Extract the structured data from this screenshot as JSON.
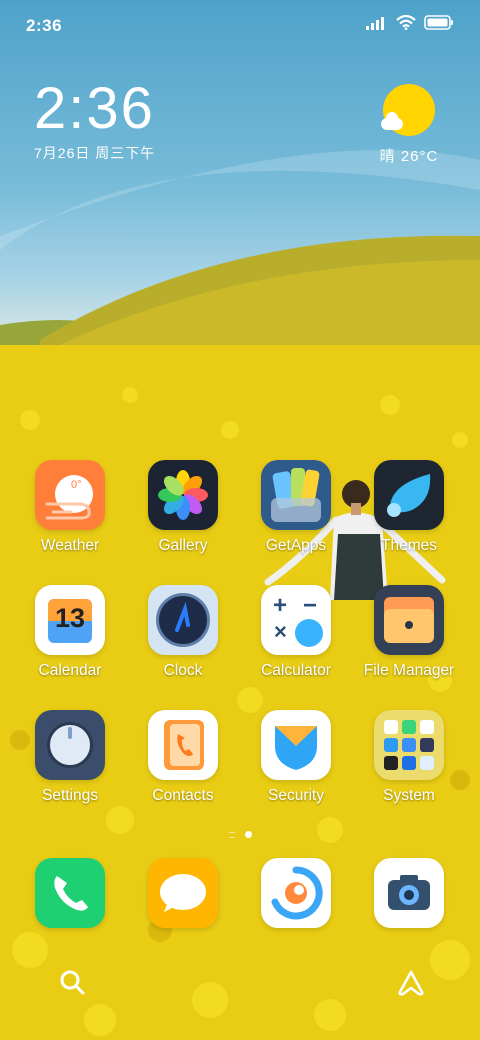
{
  "status_bar": {
    "time": "2:36"
  },
  "clock_widget": {
    "time": "2:36",
    "date": "7月26日 周三下午"
  },
  "weather_widget": {
    "text": "晴 26°C"
  },
  "apps": {
    "weather": "Weather",
    "gallery": "Gallery",
    "getapps": "GetApps",
    "themes": "Themes",
    "calendar": "Calendar",
    "calendar_day": "13",
    "clock": "Clock",
    "calculator": "Calculator",
    "file_manager": "File Manager",
    "settings": "Settings",
    "contacts": "Contacts",
    "security": "Security",
    "system": "System",
    "weather_icon_text": "0°"
  },
  "dock": [
    "phone-icon",
    "messages-icon",
    "browser-icon",
    "camera-icon"
  ],
  "bottom_bar": [
    "search-icon",
    "app-vault-icon"
  ],
  "colors": {
    "weather_icon": "#ff7f3a",
    "gallery_icon": "#1c2433",
    "phone_icon": "#1fd073",
    "messages_icon": "#ffb600",
    "sun": "#ffd400"
  }
}
